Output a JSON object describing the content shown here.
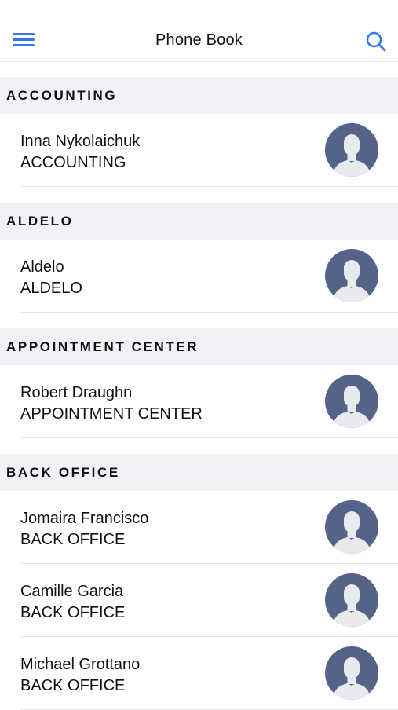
{
  "header": {
    "title": "Phone Book",
    "menu_icon": "hamburger-menu-icon",
    "search_icon": "search-icon"
  },
  "colors": {
    "accent": "#3478f6",
    "section_bg": "#f2f2f6",
    "avatar_bg": "#556389",
    "avatar_fg": "#e8eaee"
  },
  "sections": [
    {
      "title": "ACCOUNTING",
      "contacts": [
        {
          "name": "Inna Nykolaichuk",
          "department": "ACCOUNTING"
        }
      ]
    },
    {
      "title": "ALDELO",
      "contacts": [
        {
          "name": "Aldelo",
          "department": "ALDELO"
        }
      ]
    },
    {
      "title": "APPOINTMENT CENTER",
      "contacts": [
        {
          "name": "Robert Draughn",
          "department": "APPOINTMENT CENTER"
        }
      ]
    },
    {
      "title": "BACK OFFICE",
      "contacts": [
        {
          "name": "Jomaira Francisco",
          "department": "BACK OFFICE"
        },
        {
          "name": "Camille Garcia",
          "department": "BACK OFFICE"
        },
        {
          "name": "Michael Grottano",
          "department": "BACK OFFICE"
        }
      ]
    }
  ]
}
